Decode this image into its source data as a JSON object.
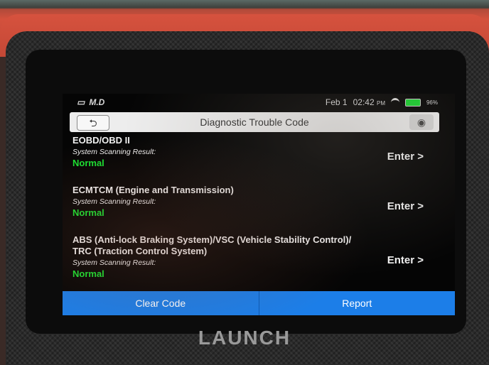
{
  "status_bar": {
    "carrier_label": "M.D",
    "date": "Feb 1",
    "time": "02:42",
    "time_suffix": "PM",
    "battery": "96%"
  },
  "header": {
    "title": "Diagnostic Trouble Code"
  },
  "systems": [
    {
      "name": "EOBD/OBD II",
      "result_label": "System Scanning Result:",
      "status": "Normal",
      "enter_label": "Enter >"
    },
    {
      "name": "ECMTCM (Engine and Transmission)",
      "result_label": "System Scanning Result:",
      "status": "Normal",
      "enter_label": "Enter >"
    },
    {
      "name_line1": "ABS (Anti-lock Braking System)/VSC (Vehicle Stability Control)/",
      "name_line2": "TRC (Traction Control System)",
      "result_label": "System Scanning Result:",
      "status": "Normal",
      "enter_label": "Enter >"
    }
  ],
  "actions": {
    "clear_code_label": "Clear Code",
    "report_label": "Report"
  },
  "device": {
    "brand": "LAUNCH"
  },
  "colors": {
    "normal_status": "#19e331",
    "action_bar": "#1c7ee8"
  }
}
